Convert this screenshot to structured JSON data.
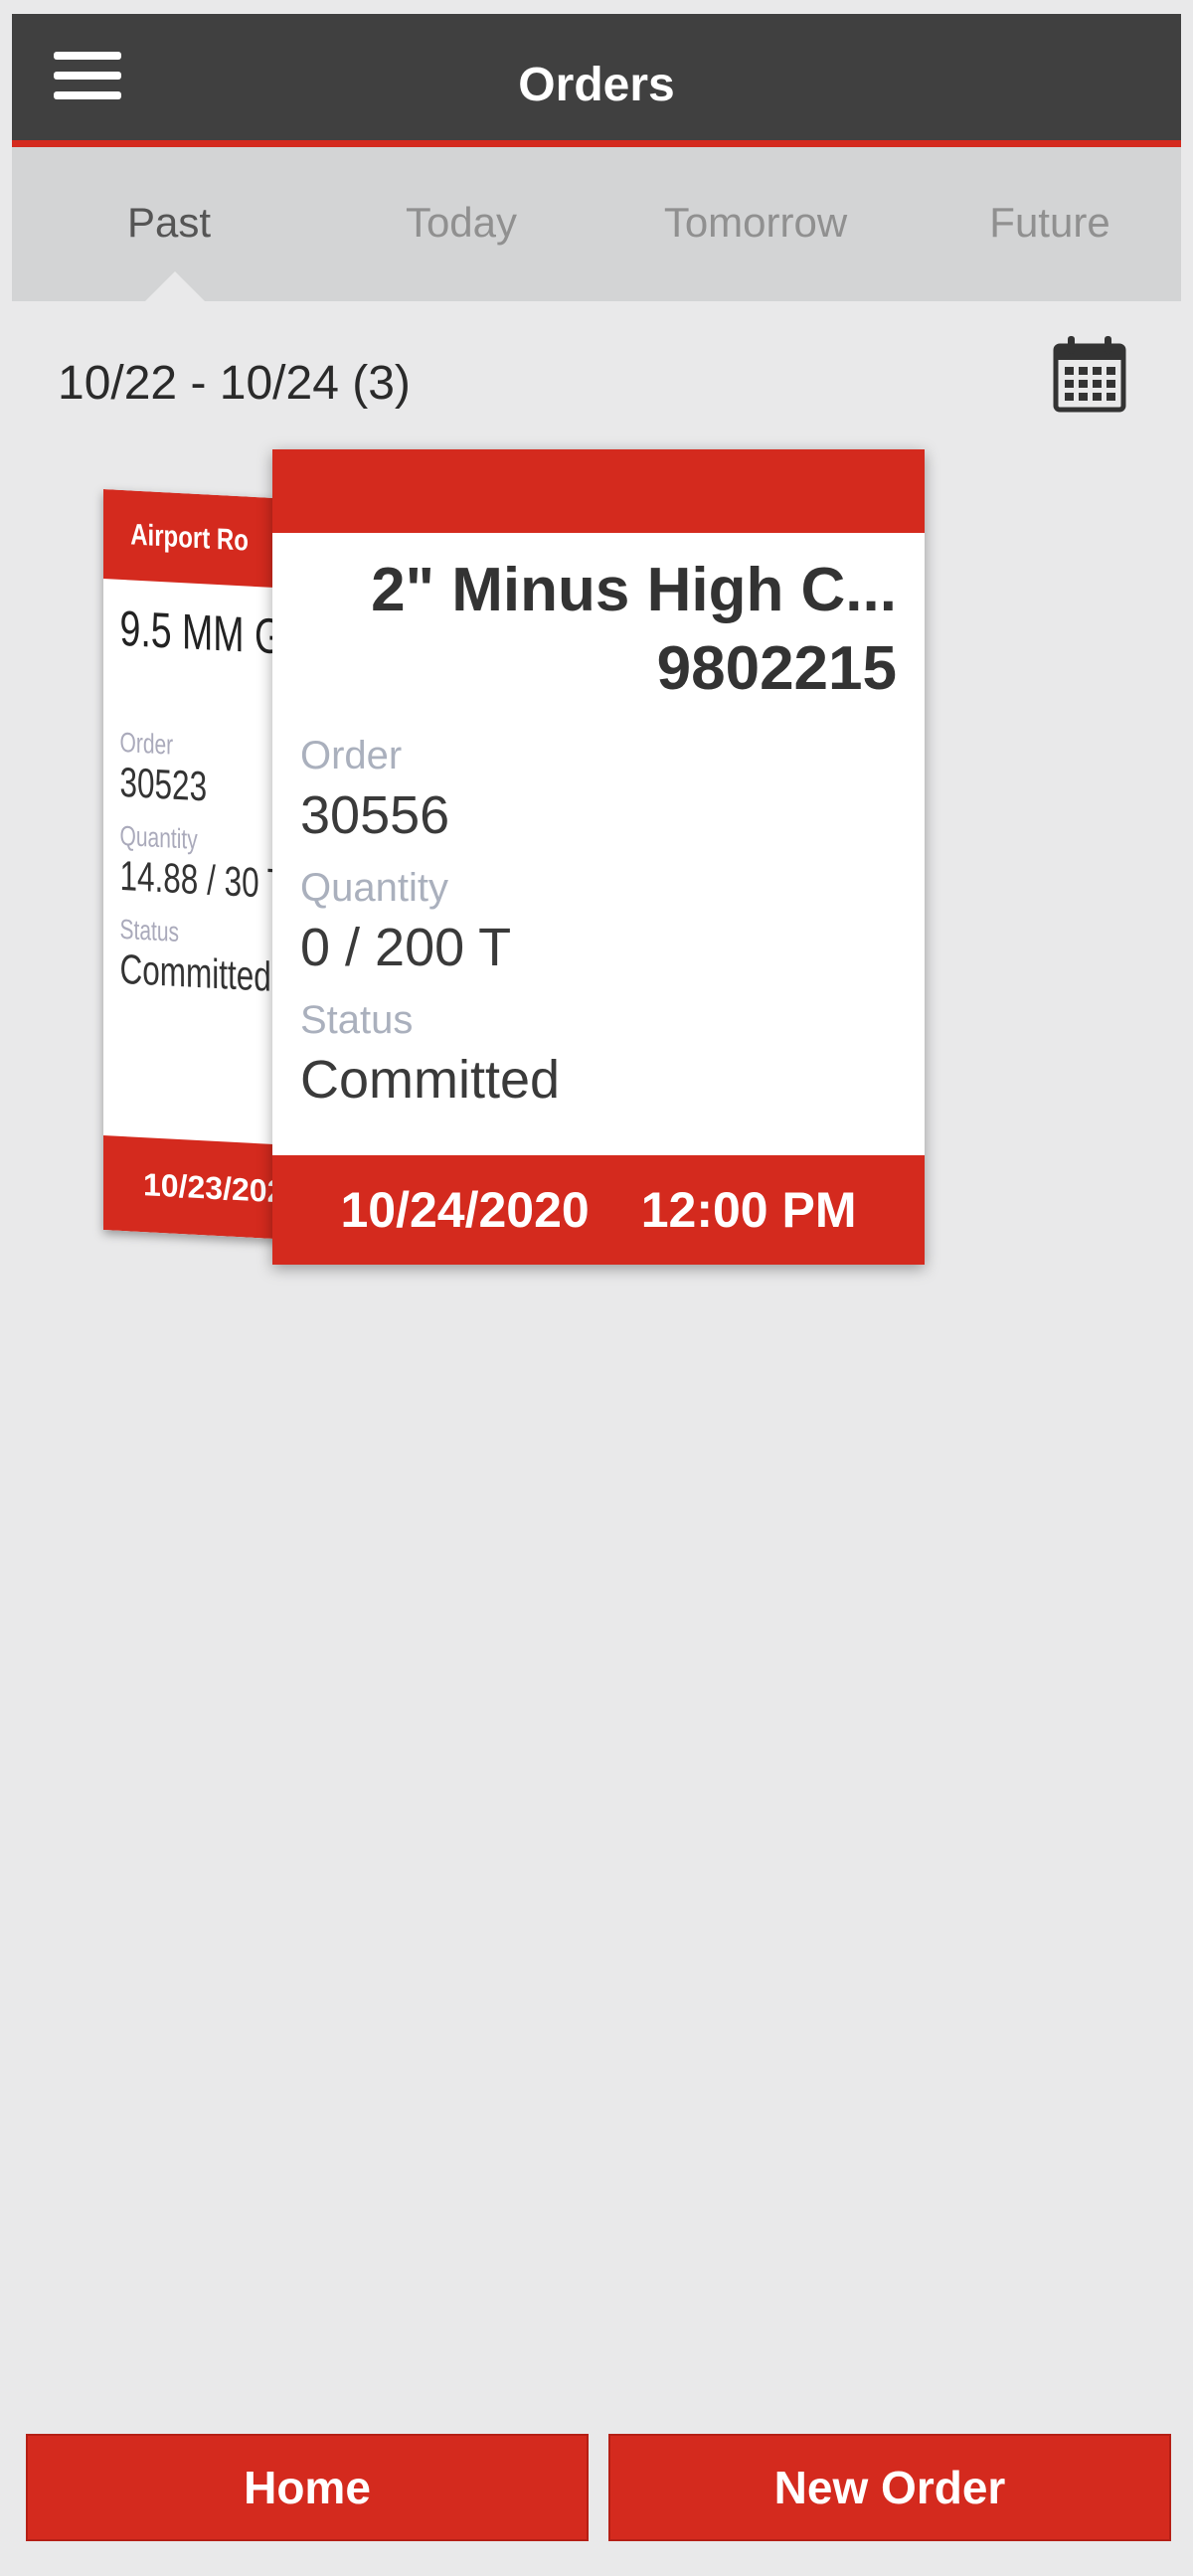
{
  "header": {
    "title": "Orders",
    "menu_icon": "hamburger-menu-icon"
  },
  "tabs": [
    {
      "label": "Past",
      "active": true
    },
    {
      "label": "Today",
      "active": false
    },
    {
      "label": "Tomorrow",
      "active": false
    },
    {
      "label": "Future",
      "active": false
    }
  ],
  "range": {
    "label": "10/22 - 10/24 (3)",
    "icon": "calendar-icon"
  },
  "back_card": {
    "location": "Airport Ro",
    "product": "9.5 MM G",
    "order_label": "Order",
    "order": "30523",
    "quantity_label": "Quantity",
    "quantity": "14.88 / 30 T",
    "status_label": "Status",
    "status": "Committed",
    "date": "10/23/2020"
  },
  "card": {
    "product": "2\" Minus High C...",
    "code": "9802215",
    "order_label": "Order",
    "order": "30556",
    "quantity_label": "Quantity",
    "quantity": "0 / 200 T",
    "status_label": "Status",
    "status": "Committed",
    "date": "10/24/2020",
    "time": "12:00 PM"
  },
  "footer": {
    "home_label": "Home",
    "new_order_label": "New Order"
  },
  "colors": {
    "accent": "#d42a1e",
    "header_bg": "#404040",
    "tab_bg": "#d3d4d5",
    "page_bg": "#e9e9ea"
  }
}
